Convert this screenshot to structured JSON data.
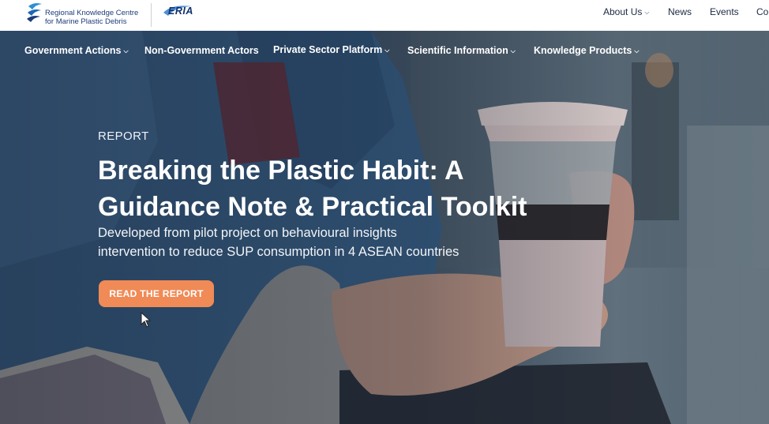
{
  "header": {
    "logo_rkc": {
      "line1": "Regional Knowledge Centre",
      "line2": "for Marine Plastic Debris"
    },
    "logo_eria": "ERIA",
    "top_nav": [
      {
        "label": "About Us",
        "has_dropdown": true
      },
      {
        "label": "News",
        "has_dropdown": false
      },
      {
        "label": "Events",
        "has_dropdown": false
      },
      {
        "label": "Co",
        "has_dropdown": false
      }
    ]
  },
  "main_nav": [
    {
      "label": "Government Actions",
      "has_dropdown": true
    },
    {
      "label": "Non-Government Actors",
      "has_dropdown": false
    },
    {
      "label": "Private Sector Platform",
      "has_dropdown": true
    },
    {
      "label": "Scientific Information",
      "has_dropdown": true
    },
    {
      "label": "Knowledge Products",
      "has_dropdown": true
    }
  ],
  "hero": {
    "eyebrow": "REPORT",
    "title_line1": "Breaking the Plastic Habit: A",
    "title_line2": "Guidance Note & Practical Toolkit",
    "subtitle_line1": "Developed from pilot project on behavioural insights",
    "subtitle_line2": "intervention to reduce SUP consumption in 4 ASEAN countries",
    "cta_label": "READ THE REPORT"
  },
  "colors": {
    "accent": "#f08a56",
    "brand_navy": "#1d3d7a",
    "header_bg": "#ffffff",
    "hero_text": "#ffffff"
  },
  "icons": {
    "caret": "chevron-down-icon",
    "cursor": "mouse-pointer-icon"
  }
}
